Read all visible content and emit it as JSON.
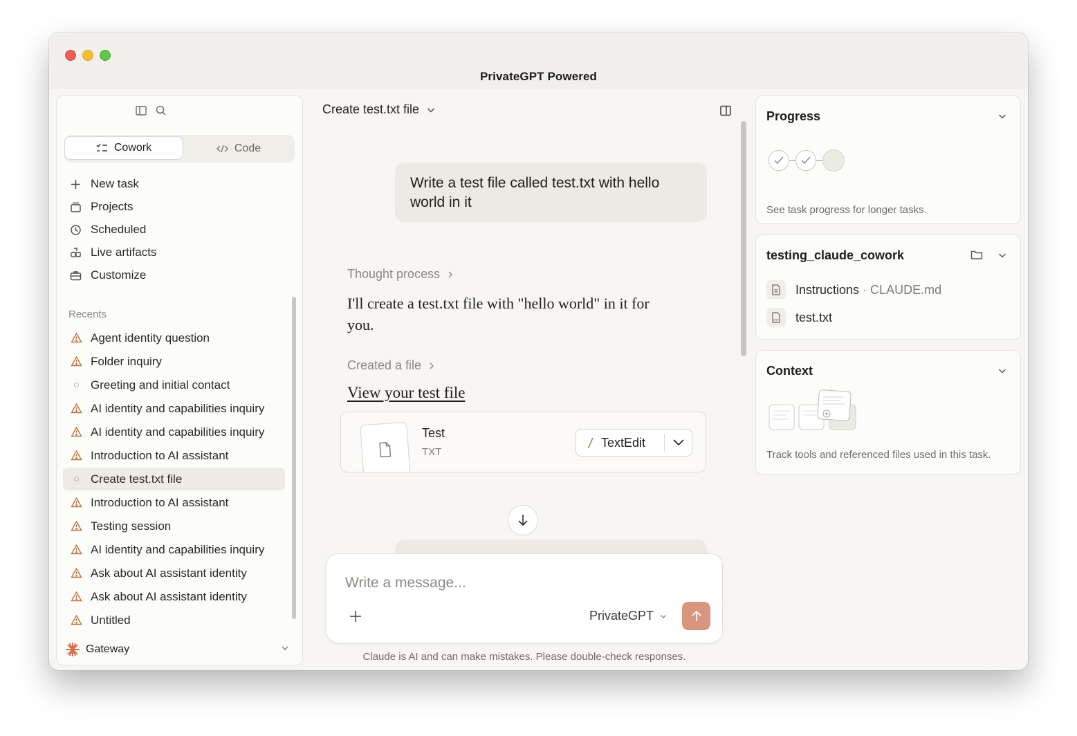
{
  "window": {
    "title": "PrivateGPT Powered"
  },
  "sidebar": {
    "modes": [
      {
        "label": "Cowork",
        "icon": "checklist-icon",
        "active": true
      },
      {
        "label": "Code",
        "icon": "code-icon",
        "active": false
      }
    ],
    "nav": [
      {
        "label": "New task",
        "icon": "plus-icon"
      },
      {
        "label": "Projects",
        "icon": "projects-icon"
      },
      {
        "label": "Scheduled",
        "icon": "clock-icon"
      },
      {
        "label": "Live artifacts",
        "icon": "artifacts-icon"
      },
      {
        "label": "Customize",
        "icon": "briefcase-icon"
      }
    ],
    "recents_label": "Recents",
    "recents": [
      {
        "label": "Agent identity question",
        "status": "warning"
      },
      {
        "label": "Folder inquiry",
        "status": "warning"
      },
      {
        "label": "Greeting and initial contact",
        "status": "idle"
      },
      {
        "label": "AI identity and capabilities inquiry",
        "status": "warning"
      },
      {
        "label": "AI identity and capabilities inquiry",
        "status": "warning"
      },
      {
        "label": "Introduction to AI assistant",
        "status": "warning"
      },
      {
        "label": "Create test.txt file",
        "status": "idle",
        "selected": true
      },
      {
        "label": "Introduction to AI assistant",
        "status": "warning"
      },
      {
        "label": "Testing session",
        "status": "warning"
      },
      {
        "label": "AI identity and capabilities inquiry",
        "status": "warning"
      },
      {
        "label": "Ask about AI assistant identity",
        "status": "warning"
      },
      {
        "label": "Ask about AI assistant identity",
        "status": "warning"
      },
      {
        "label": "Untitled",
        "status": "warning"
      }
    ],
    "footer": {
      "label": "Gateway",
      "icon": "sparkle-logo-icon"
    }
  },
  "chat": {
    "title": "Create test.txt file",
    "user_message": "Write a test file called test.txt with hello world in it",
    "thought_label": "Thought process",
    "assistant_message": "I'll create a test.txt file with \"hello world\" in it for you.",
    "created_label": "Created a file",
    "link_text": "View your test file",
    "file": {
      "name": "Test",
      "type": "TXT",
      "open_with": "TextEdit"
    },
    "composer": {
      "placeholder": "Write a message...",
      "model": "PrivateGPT"
    },
    "disclaimer": "Claude is AI and can make mistakes. Please double-check responses."
  },
  "panels": {
    "progress": {
      "title": "Progress",
      "note": "See task progress for longer tasks.",
      "steps_completed": 2,
      "steps_total": 3
    },
    "folder": {
      "title": "testing_claude_cowork",
      "files": [
        {
          "name": "Instructions",
          "detail": "· CLAUDE.md",
          "icon": "document-icon"
        },
        {
          "name": "test.txt",
          "detail": "",
          "icon": "txt-file-icon"
        }
      ]
    },
    "context": {
      "title": "Context",
      "note": "Track tools and referenced files used in this task."
    }
  },
  "colors": {
    "accent": "#d9957f",
    "warning": "#c0703a",
    "sidebar_bg": "#fcfcfa",
    "window_bg": "#f7f6f3"
  }
}
